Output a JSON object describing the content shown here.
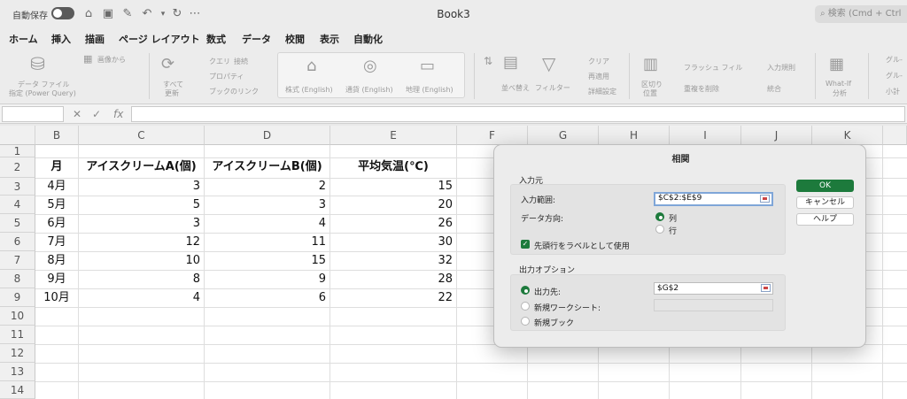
{
  "titlebar": {
    "autosave_label": "自動保存",
    "title": "Book3",
    "search_placeholder": "検索 (Cmd + Ctrl"
  },
  "tabs": [
    "ホーム",
    "挿入",
    "描画",
    "ページ レイアウト",
    "数式",
    "データ",
    "校閲",
    "表示",
    "自動化"
  ],
  "active_tab": "データ",
  "ribbon": {
    "get_data_line1": "データ ファイル",
    "get_data_line2": "指定 (Power Query)",
    "from_picture": "画像から",
    "refresh_all_line1": "すべて",
    "refresh_all_line2": "更新",
    "queries": "クエリ",
    "connections": "接続",
    "properties": "プロパティ",
    "workbook_links": "ブックのリンク",
    "stocks": "株式 (English)",
    "currencies": "通貨 (English)",
    "geography": "地理 (English)",
    "sort": "並べ替え",
    "filter": "フィルター",
    "clear": "クリア",
    "reapply": "再適用",
    "advanced": "詳細設定",
    "text_to_columns_line1": "区切り",
    "text_to_columns_line2": "位置",
    "flash_fill": "フラッシュ フィル",
    "remove_duplicates": "重複を削除",
    "data_validation": "入力規則",
    "consolidate": "統合",
    "whatif_line1": "What-If",
    "whatif_line2": "分析",
    "group": "グル-",
    "ungroup": "グル-",
    "subtotal": "小計"
  },
  "formula_bar": {
    "fx": "fx",
    "value": ""
  },
  "sheet": {
    "columns": [
      "B",
      "C",
      "D",
      "E",
      "F",
      "G",
      "H",
      "I",
      "J",
      "K"
    ],
    "rows": [
      "1",
      "2",
      "3",
      "4",
      "5",
      "6",
      "7",
      "8",
      "9",
      "10",
      "11",
      "12",
      "13",
      "14"
    ],
    "headers": {
      "month": "月",
      "ice_a": "アイスクリームA(個)",
      "ice_b": "アイスクリームB(個)",
      "temp": "平均気温(℃)"
    },
    "data": [
      {
        "month": "4月",
        "a": "3",
        "b": "2",
        "t": "15"
      },
      {
        "month": "5月",
        "a": "5",
        "b": "3",
        "t": "20"
      },
      {
        "month": "6月",
        "a": "3",
        "b": "4",
        "t": "26"
      },
      {
        "month": "7月",
        "a": "12",
        "b": "11",
        "t": "30"
      },
      {
        "month": "8月",
        "a": "10",
        "b": "15",
        "t": "32"
      },
      {
        "month": "9月",
        "a": "8",
        "b": "9",
        "t": "28"
      },
      {
        "month": "10月",
        "a": "4",
        "b": "6",
        "t": "22"
      }
    ]
  },
  "dialog": {
    "title": "相関",
    "input_section": "入力元",
    "input_range_label": "入力範囲:",
    "input_range_value": "$C$2:$E$9",
    "grouped_by_label": "データ方向:",
    "grouped_columns": "列",
    "grouped_rows": "行",
    "labels_first_row": "先頭行をラベルとして使用",
    "output_section": "出力オプション",
    "output_range_label": "出力先:",
    "output_range_value": "$G$2",
    "new_worksheet_label": "新規ワークシート:",
    "new_workbook_label": "新規ブック",
    "ok": "OK",
    "cancel": "キャンセル",
    "help": "ヘルプ"
  },
  "colors": {
    "accent": "#1d7a3c",
    "focus": "#7fa6d8"
  }
}
